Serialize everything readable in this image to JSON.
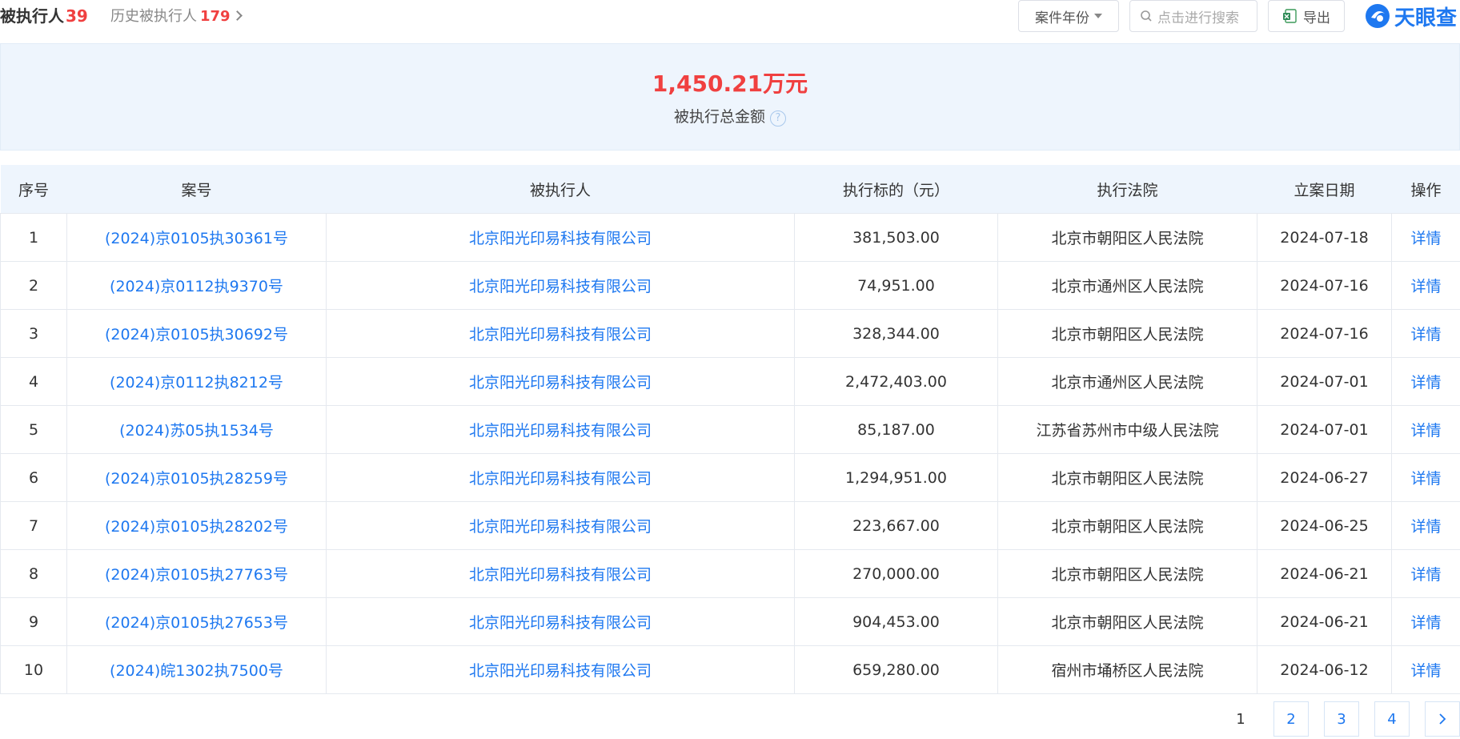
{
  "header": {
    "title": "被执行人",
    "title_count": "39",
    "history_label": "历史被执行人",
    "history_count": "179",
    "year_filter_label": "案件年份",
    "search_placeholder": "点击进行搜索",
    "export_label": "导出",
    "logo_text": "天眼查"
  },
  "summary": {
    "amount": "1,450.21万元",
    "label": "被执行总金额",
    "help_icon": "question-circle-icon"
  },
  "table": {
    "columns": [
      "序号",
      "案号",
      "被执行人",
      "执行标的（元）",
      "执行法院",
      "立案日期",
      "操作"
    ],
    "rows": [
      {
        "no": "1",
        "case": "(2024)京0105执30361号",
        "party": "北京阳光印易科技有限公司",
        "amount": "381,503.00",
        "court": "北京市朝阳区人民法院",
        "date": "2024-07-18",
        "action": "详情"
      },
      {
        "no": "2",
        "case": "(2024)京0112执9370号",
        "party": "北京阳光印易科技有限公司",
        "amount": "74,951.00",
        "court": "北京市通州区人民法院",
        "date": "2024-07-16",
        "action": "详情"
      },
      {
        "no": "3",
        "case": "(2024)京0105执30692号",
        "party": "北京阳光印易科技有限公司",
        "amount": "328,344.00",
        "court": "北京市朝阳区人民法院",
        "date": "2024-07-16",
        "action": "详情"
      },
      {
        "no": "4",
        "case": "(2024)京0112执8212号",
        "party": "北京阳光印易科技有限公司",
        "amount": "2,472,403.00",
        "court": "北京市通州区人民法院",
        "date": "2024-07-01",
        "action": "详情"
      },
      {
        "no": "5",
        "case": "(2024)苏05执1534号",
        "party": "北京阳光印易科技有限公司",
        "amount": "85,187.00",
        "court": "江苏省苏州市中级人民法院",
        "date": "2024-07-01",
        "action": "详情"
      },
      {
        "no": "6",
        "case": "(2024)京0105执28259号",
        "party": "北京阳光印易科技有限公司",
        "amount": "1,294,951.00",
        "court": "北京市朝阳区人民法院",
        "date": "2024-06-27",
        "action": "详情"
      },
      {
        "no": "7",
        "case": "(2024)京0105执28202号",
        "party": "北京阳光印易科技有限公司",
        "amount": "223,667.00",
        "court": "北京市朝阳区人民法院",
        "date": "2024-06-25",
        "action": "详情"
      },
      {
        "no": "8",
        "case": "(2024)京0105执27763号",
        "party": "北京阳光印易科技有限公司",
        "amount": "270,000.00",
        "court": "北京市朝阳区人民法院",
        "date": "2024-06-21",
        "action": "详情"
      },
      {
        "no": "9",
        "case": "(2024)京0105执27653号",
        "party": "北京阳光印易科技有限公司",
        "amount": "904,453.00",
        "court": "北京市朝阳区人民法院",
        "date": "2024-06-21",
        "action": "详情"
      },
      {
        "no": "10",
        "case": "(2024)皖1302执7500号",
        "party": "北京阳光印易科技有限公司",
        "amount": "659,280.00",
        "court": "宿州市埇桥区人民法院",
        "date": "2024-06-12",
        "action": "详情"
      }
    ]
  },
  "pagination": {
    "pages": [
      "1",
      "2",
      "3",
      "4"
    ],
    "current": "1",
    "next_icon": "chevron-right-icon"
  },
  "colors": {
    "accent": "#1e78f0",
    "highlight": "#f04040",
    "summary_bg": "#eef5fd"
  }
}
